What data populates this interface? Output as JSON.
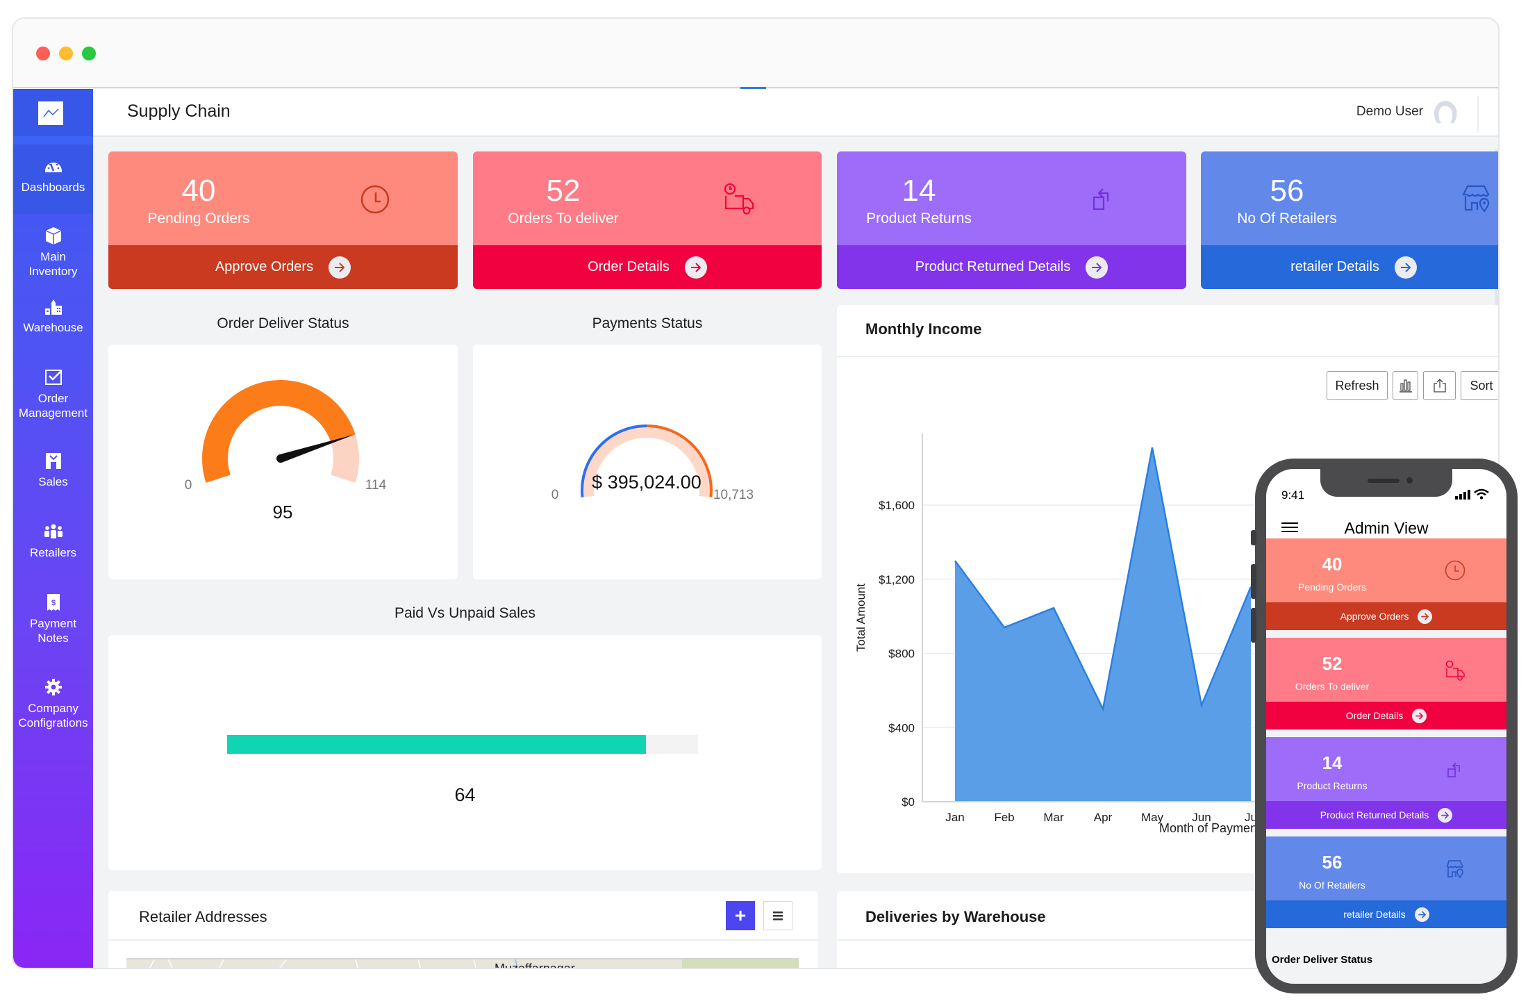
{
  "window": {
    "traffic_lights": [
      {
        "name": "close",
        "color": "#ff5f57"
      },
      {
        "name": "minimize",
        "color": "#febc2e"
      },
      {
        "name": "maximize",
        "color": "#28c840"
      }
    ]
  },
  "header": {
    "title": "Supply Chain",
    "user_name": "Demo User"
  },
  "sidebar": {
    "logo_icon": "line-chart-icon",
    "items": [
      {
        "label": "Dashboards",
        "icon": "speedometer-icon",
        "active": true
      },
      {
        "label": "Main\nInventory",
        "icon": "box-icon",
        "active": false
      },
      {
        "label": "Warehouse",
        "icon": "buildings-icon",
        "active": false
      },
      {
        "label": "Order\nManagement",
        "icon": "checkbox-icon",
        "active": false
      },
      {
        "label": "Sales",
        "icon": "sales-icon",
        "active": false
      },
      {
        "label": "Retailers",
        "icon": "people-icon",
        "active": false
      },
      {
        "label": "Payment\nNotes",
        "icon": "receipt-dollar-icon",
        "active": false
      },
      {
        "label": "Company\nConfigrations",
        "icon": "gear-icon",
        "active": false
      }
    ]
  },
  "stat_cards": [
    {
      "value": "40",
      "label": "Pending Orders",
      "link": "Approve Orders",
      "icon": "clock-icon",
      "top_color": "#fe8a7e",
      "bottom_color": "#c93a21",
      "icon_color": "#c93a21"
    },
    {
      "value": "52",
      "label": "Orders To deliver",
      "link": "Order Details",
      "icon": "delivery-truck-icon",
      "top_color": "#ff7b87",
      "bottom_color": "#f20140",
      "icon_color": "#f20140"
    },
    {
      "value": "14",
      "label": "Product Returns",
      "link": "Product Returned Details",
      "icon": "return-icon",
      "top_color": "#9d6cf9",
      "bottom_color": "#8234ea",
      "icon_color": "#7430d8"
    },
    {
      "value": "56",
      "label": "No Of Retailers",
      "link": "retailer Details",
      "icon": "store-location-icon",
      "top_color": "#6288e9",
      "bottom_color": "#2669db",
      "icon_color": "#2457c4"
    }
  ],
  "order_deliver_status": {
    "title": "Order Deliver Status",
    "min_label": "0",
    "max_label": "114",
    "value_label": "95",
    "value": 95,
    "min": 0,
    "max": 114,
    "fill_color": "#fd7c1a",
    "track_color": "#fdd3c3"
  },
  "payments_status": {
    "title": "Payments Status",
    "min_label": "0",
    "max_label": "10,713",
    "value_label": "$ 395,024.00",
    "fill_fraction": 1.0,
    "track_color": "#fdd8c8",
    "left_color": "#2d6ff2",
    "right_color": "#f4681f"
  },
  "paid_vs_unpaid": {
    "title": "Paid Vs Unpaid Sales",
    "value_label": "64",
    "fill_fraction": 0.89,
    "fill_color": "#0fd5b3",
    "track_color": "#f3f3f4"
  },
  "monthly_income": {
    "title": "Monthly Income",
    "buttons": {
      "refresh": "Refresh",
      "chart_type_icon": "bar-chart-icon",
      "export_icon": "share-export-icon",
      "sort": "Sort"
    }
  },
  "chart_data": {
    "type": "area",
    "title": "Monthly Income",
    "xlabel": "Month of Payment",
    "ylabel": "Total Amount",
    "categories": [
      "Jan",
      "Feb",
      "Mar",
      "Apr",
      "May",
      "Jun",
      "Jul"
    ],
    "visible_tick_labels": [
      "Jan",
      "Feb",
      "Mar",
      "Apr",
      "May",
      "Jun",
      "Ju"
    ],
    "visible_xlabel": "Month of Paymen",
    "series": [
      {
        "name": "Total Amount",
        "values": [
          1300,
          940,
          1045,
          500,
          1910,
          520,
          1160
        ],
        "color": "#5b9ee8",
        "line_color": "#2a7fe0"
      }
    ],
    "yticks": [
      0,
      400,
      800,
      1200,
      1600
    ],
    "ytick_labels": [
      "$0",
      "$400",
      "$800",
      "$1,200",
      "$1,600"
    ],
    "ylim": [
      0,
      1950
    ],
    "grid": true
  },
  "retailer_addresses": {
    "title": "Retailer Addresses",
    "add_icon": "plus-icon",
    "menu_icon": "menu-icon",
    "map_label": "Muzaffarnagar"
  },
  "deliveries_by_warehouse": {
    "title": "Deliveries by Warehouse"
  },
  "phone": {
    "time": "9:41",
    "title": "Admin View",
    "section_title": "Order Deliver Status"
  }
}
